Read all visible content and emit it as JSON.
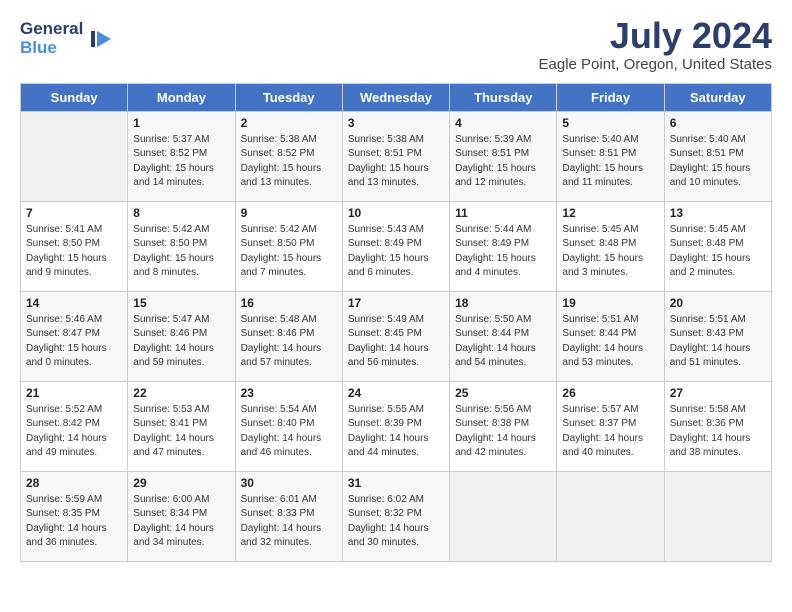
{
  "header": {
    "logo_general": "General",
    "logo_blue": "Blue",
    "month_title": "July 2024",
    "location": "Eagle Point, Oregon, United States"
  },
  "days_of_week": [
    "Sunday",
    "Monday",
    "Tuesday",
    "Wednesday",
    "Thursday",
    "Friday",
    "Saturday"
  ],
  "weeks": [
    [
      {
        "day": "",
        "content": ""
      },
      {
        "day": "1",
        "content": "Sunrise: 5:37 AM\nSunset: 8:52 PM\nDaylight: 15 hours\nand 14 minutes."
      },
      {
        "day": "2",
        "content": "Sunrise: 5:38 AM\nSunset: 8:52 PM\nDaylight: 15 hours\nand 13 minutes."
      },
      {
        "day": "3",
        "content": "Sunrise: 5:38 AM\nSunset: 8:51 PM\nDaylight: 15 hours\nand 13 minutes."
      },
      {
        "day": "4",
        "content": "Sunrise: 5:39 AM\nSunset: 8:51 PM\nDaylight: 15 hours\nand 12 minutes."
      },
      {
        "day": "5",
        "content": "Sunrise: 5:40 AM\nSunset: 8:51 PM\nDaylight: 15 hours\nand 11 minutes."
      },
      {
        "day": "6",
        "content": "Sunrise: 5:40 AM\nSunset: 8:51 PM\nDaylight: 15 hours\nand 10 minutes."
      }
    ],
    [
      {
        "day": "7",
        "content": "Sunrise: 5:41 AM\nSunset: 8:50 PM\nDaylight: 15 hours\nand 9 minutes."
      },
      {
        "day": "8",
        "content": "Sunrise: 5:42 AM\nSunset: 8:50 PM\nDaylight: 15 hours\nand 8 minutes."
      },
      {
        "day": "9",
        "content": "Sunrise: 5:42 AM\nSunset: 8:50 PM\nDaylight: 15 hours\nand 7 minutes."
      },
      {
        "day": "10",
        "content": "Sunrise: 5:43 AM\nSunset: 8:49 PM\nDaylight: 15 hours\nand 6 minutes."
      },
      {
        "day": "11",
        "content": "Sunrise: 5:44 AM\nSunset: 8:49 PM\nDaylight: 15 hours\nand 4 minutes."
      },
      {
        "day": "12",
        "content": "Sunrise: 5:45 AM\nSunset: 8:48 PM\nDaylight: 15 hours\nand 3 minutes."
      },
      {
        "day": "13",
        "content": "Sunrise: 5:45 AM\nSunset: 8:48 PM\nDaylight: 15 hours\nand 2 minutes."
      }
    ],
    [
      {
        "day": "14",
        "content": "Sunrise: 5:46 AM\nSunset: 8:47 PM\nDaylight: 15 hours\nand 0 minutes."
      },
      {
        "day": "15",
        "content": "Sunrise: 5:47 AM\nSunset: 8:46 PM\nDaylight: 14 hours\nand 59 minutes."
      },
      {
        "day": "16",
        "content": "Sunrise: 5:48 AM\nSunset: 8:46 PM\nDaylight: 14 hours\nand 57 minutes."
      },
      {
        "day": "17",
        "content": "Sunrise: 5:49 AM\nSunset: 8:45 PM\nDaylight: 14 hours\nand 56 minutes."
      },
      {
        "day": "18",
        "content": "Sunrise: 5:50 AM\nSunset: 8:44 PM\nDaylight: 14 hours\nand 54 minutes."
      },
      {
        "day": "19",
        "content": "Sunrise: 5:51 AM\nSunset: 8:44 PM\nDaylight: 14 hours\nand 53 minutes."
      },
      {
        "day": "20",
        "content": "Sunrise: 5:51 AM\nSunset: 8:43 PM\nDaylight: 14 hours\nand 51 minutes."
      }
    ],
    [
      {
        "day": "21",
        "content": "Sunrise: 5:52 AM\nSunset: 8:42 PM\nDaylight: 14 hours\nand 49 minutes."
      },
      {
        "day": "22",
        "content": "Sunrise: 5:53 AM\nSunset: 8:41 PM\nDaylight: 14 hours\nand 47 minutes."
      },
      {
        "day": "23",
        "content": "Sunrise: 5:54 AM\nSunset: 8:40 PM\nDaylight: 14 hours\nand 46 minutes."
      },
      {
        "day": "24",
        "content": "Sunrise: 5:55 AM\nSunset: 8:39 PM\nDaylight: 14 hours\nand 44 minutes."
      },
      {
        "day": "25",
        "content": "Sunrise: 5:56 AM\nSunset: 8:38 PM\nDaylight: 14 hours\nand 42 minutes."
      },
      {
        "day": "26",
        "content": "Sunrise: 5:57 AM\nSunset: 8:37 PM\nDaylight: 14 hours\nand 40 minutes."
      },
      {
        "day": "27",
        "content": "Sunrise: 5:58 AM\nSunset: 8:36 PM\nDaylight: 14 hours\nand 38 minutes."
      }
    ],
    [
      {
        "day": "28",
        "content": "Sunrise: 5:59 AM\nSunset: 8:35 PM\nDaylight: 14 hours\nand 36 minutes."
      },
      {
        "day": "29",
        "content": "Sunrise: 6:00 AM\nSunset: 8:34 PM\nDaylight: 14 hours\nand 34 minutes."
      },
      {
        "day": "30",
        "content": "Sunrise: 6:01 AM\nSunset: 8:33 PM\nDaylight: 14 hours\nand 32 minutes."
      },
      {
        "day": "31",
        "content": "Sunrise: 6:02 AM\nSunset: 8:32 PM\nDaylight: 14 hours\nand 30 minutes."
      },
      {
        "day": "",
        "content": ""
      },
      {
        "day": "",
        "content": ""
      },
      {
        "day": "",
        "content": ""
      }
    ]
  ]
}
